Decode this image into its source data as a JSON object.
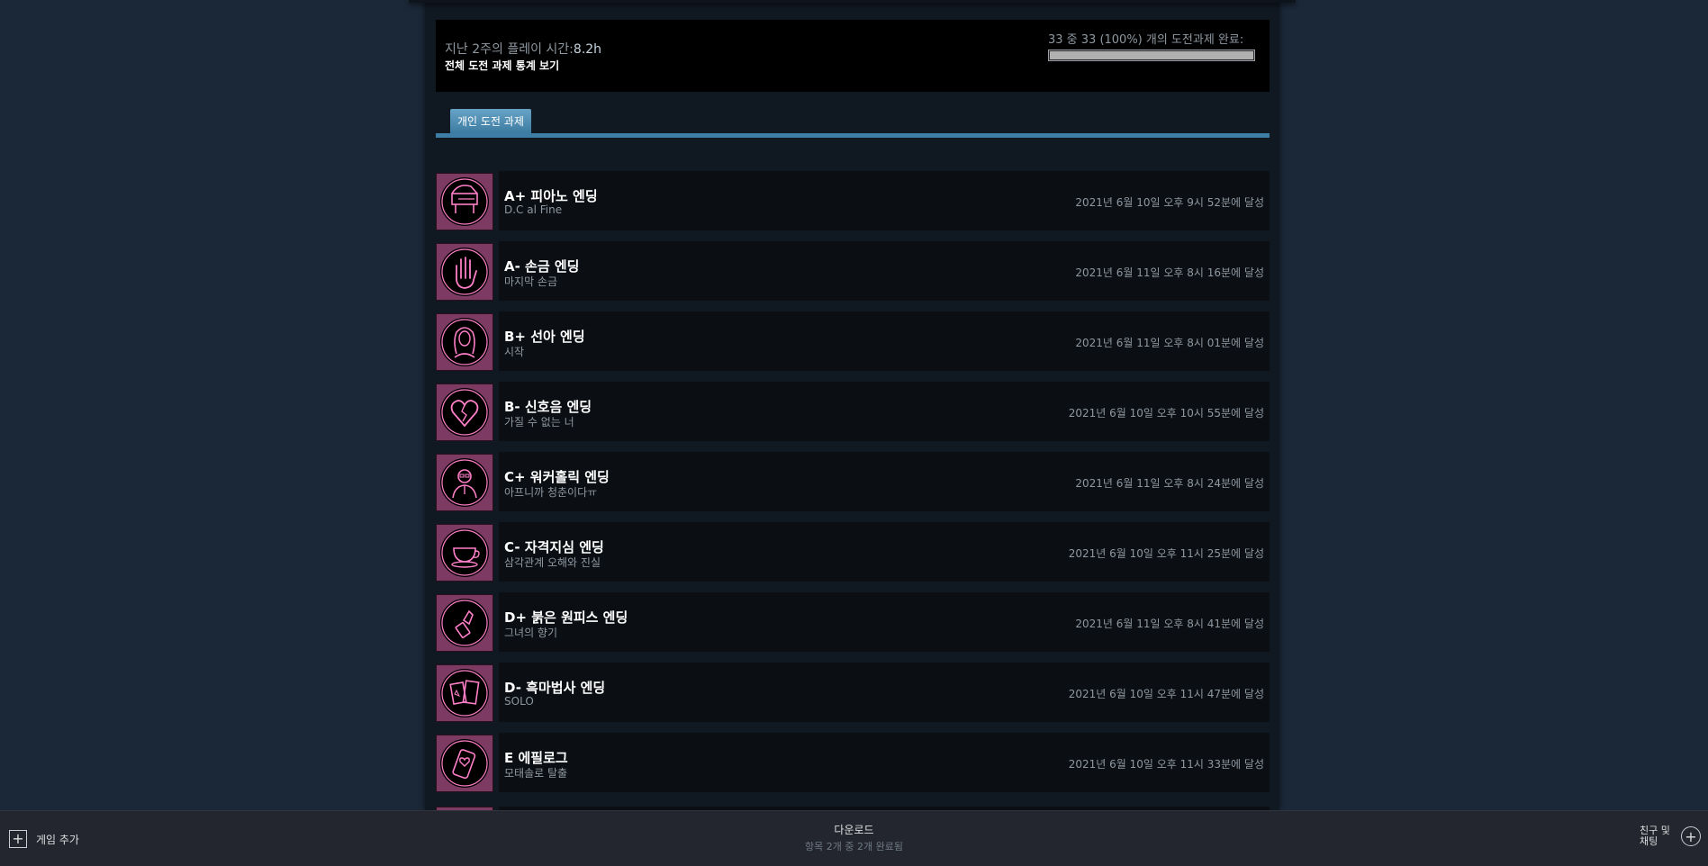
{
  "stats": {
    "playtime_label": "지난 2주의 플레이 시간:",
    "playtime_value": "8.2h",
    "all_stats_link": "전체 도전 과제 통계 보기",
    "completion_text": "33 중 33 (100%) 개의 도전과제 완료:",
    "completion_fraction": 1.0
  },
  "tabs": {
    "personal": "개인 도전 과제"
  },
  "achievements": [
    {
      "title": "A+ 피아노 엔딩",
      "desc": "D.C al Fine",
      "date": "2021년 6월 10일 오후 9시 52분에 달성",
      "icon": "piano-icon"
    },
    {
      "title": "A- 손금 엔딩",
      "desc": "마지막 손금",
      "date": "2021년 6월 11일 오후 8시 16분에 달성",
      "icon": "hand-icon"
    },
    {
      "title": "B+ 선아 엔딩",
      "desc": "시작",
      "date": "2021년 6월 11일 오후 8시 01분에 달성",
      "icon": "girl-portrait-icon"
    },
    {
      "title": "B- 신호음 엔딩",
      "desc": "가질 수 없는 너",
      "date": "2021년 6월 10일 오후 10시 55분에 달성",
      "icon": "broken-heart-icon"
    },
    {
      "title": "C+ 워커홀릭 엔딩",
      "desc": "아프니까 청춘이다ㅠ",
      "date": "2021년 6월 11일 오후 8시 24분에 달성",
      "icon": "office-man-icon"
    },
    {
      "title": "C- 자격지심 엔딩",
      "desc": "삼각관계 오해와 진실",
      "date": "2021년 6월 10일 오후 11시 25분에 달성",
      "icon": "teacup-icon"
    },
    {
      "title": "D+ 붉은 원피스 엔딩",
      "desc": "그녀의 향기",
      "date": "2021년 6월 11일 오후 8시 41분에 달성",
      "icon": "lipstick-icon"
    },
    {
      "title": "D- 흑마법사 엔딩",
      "desc": "SOLO",
      "date": "2021년 6월 10일 오후 11시 47분에 달성",
      "icon": "tarot-cards-icon"
    },
    {
      "title": "E 에필로그",
      "desc": "모태솔로 탈출",
      "date": "2021년 6월 10일 오후 11시 33분에 달성",
      "icon": "phone-heart-icon"
    }
  ],
  "footer": {
    "add_game": "게임 추가",
    "downloads_title": "다운로드",
    "downloads_status": "항목 2개 중 2개 완료됨",
    "friends_line1": "친구 및",
    "friends_line2": "채팅"
  },
  "colors": {
    "neon_pink": "#ff7fc8",
    "icon_frame": "#7d3b63",
    "tab_blue": "#3e7ea6"
  }
}
